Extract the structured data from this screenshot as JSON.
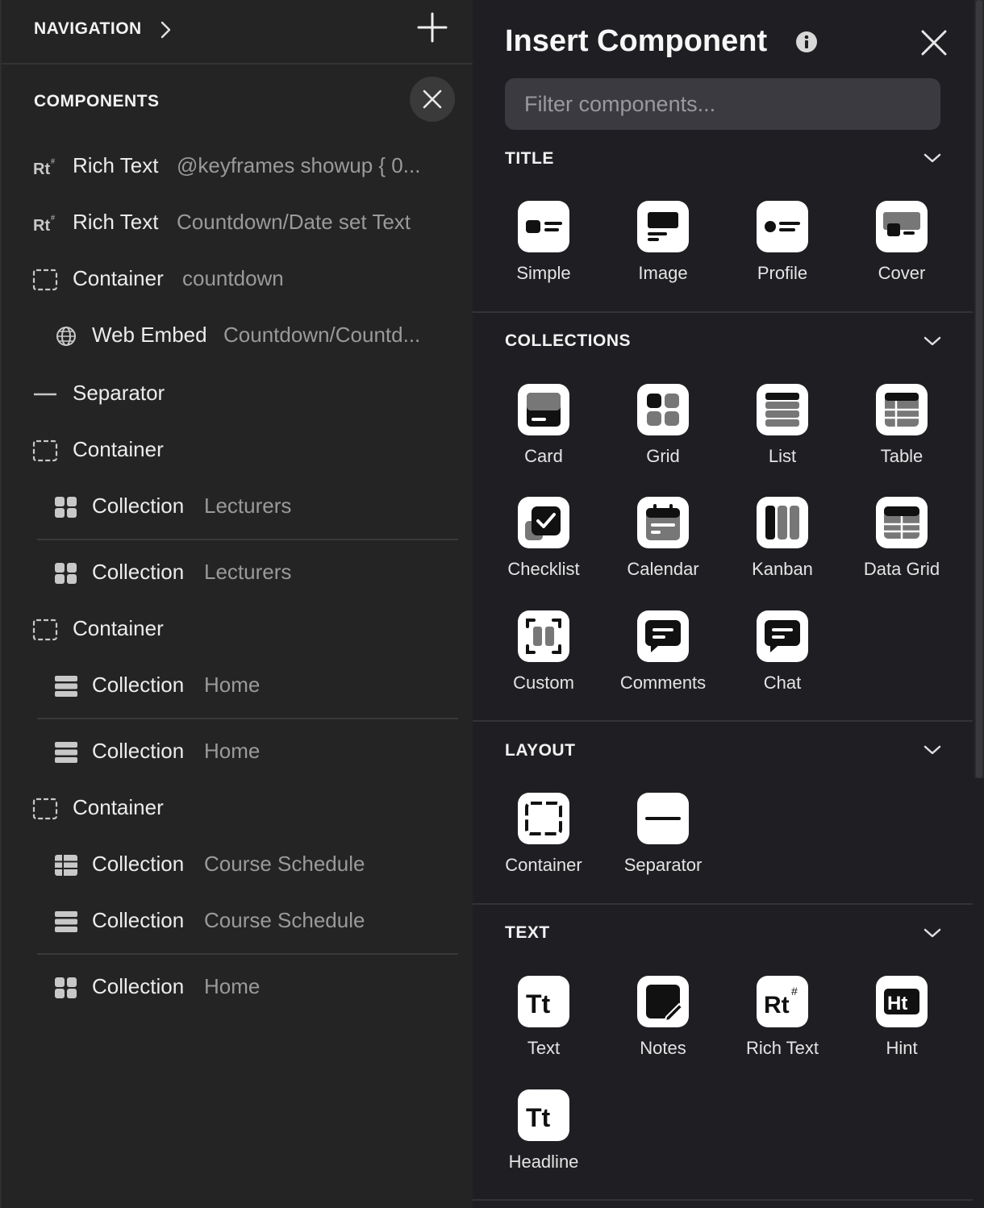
{
  "left": {
    "nav_title": "NAVIGATION",
    "components_title": "COMPONENTS",
    "items": [
      {
        "icon": "rich-text-icon",
        "name": "Rich Text",
        "sub": "@keyframes showup { 0..."
      },
      {
        "icon": "rich-text-icon",
        "name": "Rich Text",
        "sub": "Countdown/Date set Text"
      },
      {
        "icon": "container-icon",
        "name": "Container",
        "sub": "countdown"
      },
      {
        "icon": "globe-icon",
        "name": "Web Embed",
        "sub": "Countdown/Countd..."
      },
      {
        "icon": "separator-icon",
        "name": "Separator",
        "sub": ""
      },
      {
        "icon": "container-icon",
        "name": "Container",
        "sub": ""
      },
      {
        "icon": "grid-icon",
        "name": "Collection",
        "sub": "Lecturers"
      },
      {
        "icon": "grid-icon",
        "name": "Collection",
        "sub": "Lecturers"
      },
      {
        "icon": "container-icon",
        "name": "Container",
        "sub": ""
      },
      {
        "icon": "list-icon",
        "name": "Collection",
        "sub": "Home"
      },
      {
        "icon": "list-icon",
        "name": "Collection",
        "sub": "Home"
      },
      {
        "icon": "container-icon",
        "name": "Container",
        "sub": ""
      },
      {
        "icon": "table-icon",
        "name": "Collection",
        "sub": "Course Schedule"
      },
      {
        "icon": "list-icon",
        "name": "Collection",
        "sub": "Course Schedule"
      },
      {
        "icon": "grid-icon",
        "name": "Collection",
        "sub": "Home"
      }
    ]
  },
  "right": {
    "title": "Insert Component",
    "filter_placeholder": "Filter components...",
    "sections": [
      {
        "title": "TITLE",
        "tiles": [
          {
            "icon": "simple-title-icon",
            "label": "Simple"
          },
          {
            "icon": "image-title-icon",
            "label": "Image"
          },
          {
            "icon": "profile-title-icon",
            "label": "Profile"
          },
          {
            "icon": "cover-title-icon",
            "label": "Cover"
          }
        ]
      },
      {
        "title": "COLLECTIONS",
        "tiles": [
          {
            "icon": "card-icon",
            "label": "Card"
          },
          {
            "icon": "grid-icon",
            "label": "Grid"
          },
          {
            "icon": "list-icon",
            "label": "List"
          },
          {
            "icon": "table-icon",
            "label": "Table"
          },
          {
            "icon": "checklist-icon",
            "label": "Checklist"
          },
          {
            "icon": "calendar-icon",
            "label": "Calendar"
          },
          {
            "icon": "kanban-icon",
            "label": "Kanban"
          },
          {
            "icon": "data-grid-icon",
            "label": "Data Grid"
          },
          {
            "icon": "custom-icon",
            "label": "Custom"
          },
          {
            "icon": "comments-icon",
            "label": "Comments"
          },
          {
            "icon": "chat-icon",
            "label": "Chat"
          }
        ]
      },
      {
        "title": "LAYOUT",
        "tiles": [
          {
            "icon": "container-icon",
            "label": "Container"
          },
          {
            "icon": "separator-icon",
            "label": "Separator"
          }
        ]
      },
      {
        "title": "TEXT",
        "tiles": [
          {
            "icon": "text-icon",
            "label": "Text"
          },
          {
            "icon": "notes-icon",
            "label": "Notes"
          },
          {
            "icon": "rich-text-icon",
            "label": "Rich Text"
          },
          {
            "icon": "hint-icon",
            "label": "Hint"
          },
          {
            "icon": "headline-icon",
            "label": "Headline"
          }
        ]
      }
    ]
  },
  "colors": {
    "left_bg": "#242424",
    "right_bg": "#1f1f23",
    "tile_bg": "#ffffff",
    "input_bg": "#3a3a40"
  }
}
